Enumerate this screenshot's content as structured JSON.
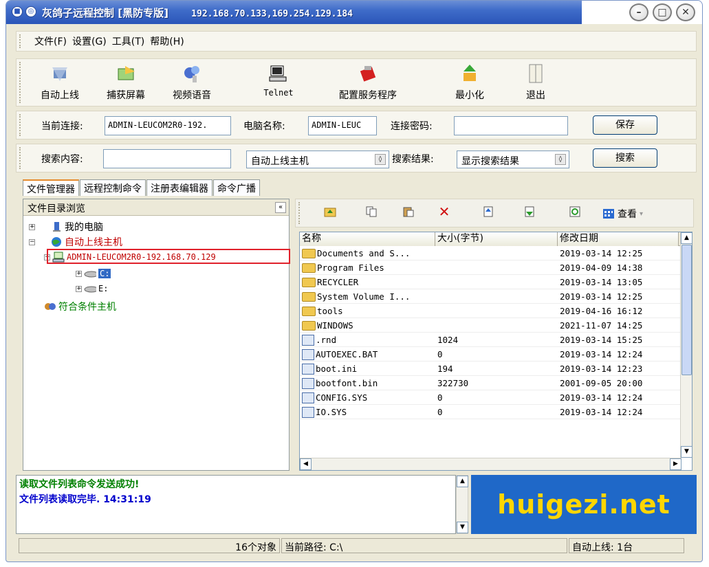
{
  "window": {
    "title": "灰鸽子远程控制 [黑防专版]",
    "ips": "192.168.70.133,169.254.129.184"
  },
  "menu": [
    "文件(F)",
    "设置(G)",
    "工具(T)",
    "帮助(H)"
  ],
  "toolbar": [
    {
      "label": "自动上线",
      "icon": "auto-online-icon"
    },
    {
      "label": "捕获屏幕",
      "icon": "capture-screen-icon"
    },
    {
      "label": "视频语音",
      "icon": "video-voice-icon"
    },
    {
      "label": "Telnet",
      "icon": "telnet-icon"
    },
    {
      "label": "配置服务程序",
      "icon": "config-server-icon"
    },
    {
      "label": "最小化",
      "icon": "minimize-icon"
    },
    {
      "label": "退出",
      "icon": "exit-icon"
    }
  ],
  "connection": {
    "current_label": "当前连接:",
    "current_value": "ADMIN-LEUCOM2R0-192.",
    "computer_label": "电脑名称:",
    "computer_value": "ADMIN-LEUC",
    "password_label": "连接密码:",
    "password_value": "",
    "save_label": "保存"
  },
  "search": {
    "content_label": "搜索内容:",
    "content_value": "",
    "scope_value": "自动上线主机",
    "result_label": "搜索结果:",
    "result_value": "显示搜索结果",
    "search_label": "搜索"
  },
  "tabs": [
    "文件管理器",
    "远程控制命令",
    "注册表编辑器",
    "命令广播"
  ],
  "tree": {
    "header": "文件目录浏览",
    "my_computer": "我的电脑",
    "auto_online": "自动上线主机",
    "host": "ADMIN-LEUCOM2R0-192.168.70.129",
    "drive_c": "C:",
    "drive_e": "E:",
    "matching": "符合条件主机"
  },
  "right_toolbar": {
    "view_label": "查看"
  },
  "files": {
    "columns": [
      "名称",
      "大小(字节)",
      "修改日期"
    ],
    "rows": [
      {
        "name": "Documents and S...",
        "size": "",
        "date": "2019-03-14 12:25",
        "type": "folder"
      },
      {
        "name": "Program Files",
        "size": "",
        "date": "2019-04-09 14:38",
        "type": "folder"
      },
      {
        "name": "RECYCLER",
        "size": "",
        "date": "2019-03-14 13:05",
        "type": "folder"
      },
      {
        "name": "System Volume I...",
        "size": "",
        "date": "2019-03-14 12:25",
        "type": "folder"
      },
      {
        "name": "tools",
        "size": "",
        "date": "2019-04-16 16:12",
        "type": "folder"
      },
      {
        "name": "WINDOWS",
        "size": "",
        "date": "2021-11-07 14:25",
        "type": "folder"
      },
      {
        "name": ".rnd",
        "size": "1024",
        "date": "2019-03-14 15:25",
        "type": "file"
      },
      {
        "name": "AUTOEXEC.BAT",
        "size": "0",
        "date": "2019-03-14 12:24",
        "type": "file"
      },
      {
        "name": "boot.ini",
        "size": "194",
        "date": "2019-03-14 12:23",
        "type": "file"
      },
      {
        "name": "bootfont.bin",
        "size": "322730",
        "date": "2001-09-05 20:00",
        "type": "file"
      },
      {
        "name": "CONFIG.SYS",
        "size": "0",
        "date": "2019-03-14 12:24",
        "type": "file"
      },
      {
        "name": "IO.SYS",
        "size": "0",
        "date": "2019-03-14 12:24",
        "type": "file"
      }
    ]
  },
  "log": {
    "line1": "读取文件列表命令发送成功!",
    "line2": "文件列表读取完毕. 14:31:19"
  },
  "banner": "huigezi.net",
  "status": {
    "objects": "16个对象",
    "path": "当前路径: C:\\",
    "online": "自动上线: 1台"
  }
}
